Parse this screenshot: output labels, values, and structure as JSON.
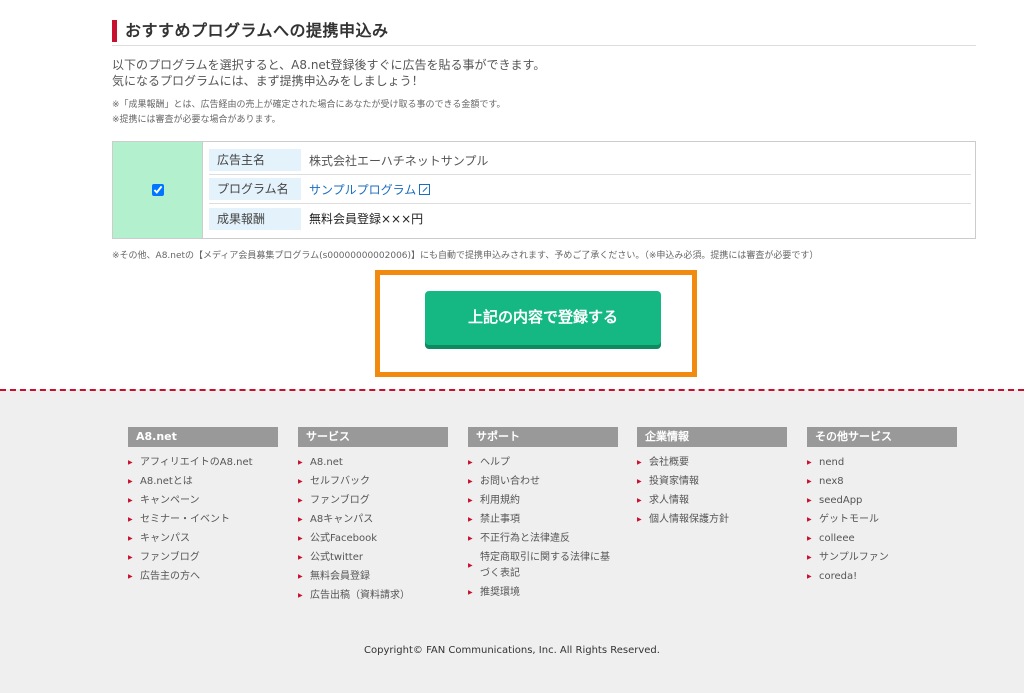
{
  "section": {
    "title": "おすすめプログラムへの提携申込み",
    "intro_line1": "以下のプログラムを選択すると、A8.net登録後すぐに広告を貼る事ができます。",
    "intro_line2": "気になるプログラムには、まず提携申込みをしましょう！",
    "note1": "※「成果報酬」とは、広告経由の売上が確定された場合にあなたが受け取る事のできる金額です。",
    "note2": "※提携には審査が必要な場合があります。"
  },
  "program": {
    "checked": true,
    "rows": [
      {
        "label": "広告主名",
        "value": "株式会社エーハチネットサンプル"
      },
      {
        "label": "プログラム名",
        "value": "サンプルプログラム"
      },
      {
        "label": "成果報酬",
        "value": "無料会員登録×××円"
      }
    ]
  },
  "auto_note": "※その他、A8.netの【メディア会員募集プログラム(s00000000002006)】にも自動で提携申込みされます、予めご了承ください。（※申込み必須。提携には審査が必要です）",
  "submit_label": "上記の内容で登録する",
  "colors": {
    "accent_red": "#c8102e",
    "button_green": "#15b883",
    "highlight_orange": "#f28a0f",
    "check_cell_bg": "#b3f0cd"
  },
  "footer": {
    "columns": [
      {
        "head": "A8.net",
        "items": [
          "アフィリエイトのA8.net",
          "A8.netとは",
          "キャンペーン",
          "セミナー・イベント",
          "キャンパス",
          "ファンブログ",
          "広告主の方へ"
        ]
      },
      {
        "head": "サービス",
        "items": [
          "A8.net",
          "セルフバック",
          "ファンブログ",
          "A8キャンパス",
          "公式Facebook",
          "公式twitter",
          "無料会員登録",
          "広告出稿（資料請求）"
        ]
      },
      {
        "head": "サポート",
        "items": [
          "ヘルプ",
          "お問い合わせ",
          "利用規約",
          "禁止事項",
          "不正行為と法律違反",
          "特定商取引に関する法律に基づく表記",
          "推奨環境"
        ]
      },
      {
        "head": "企業情報",
        "items": [
          "会社概要",
          "投資家情報",
          "求人情報",
          "個人情報保護方針"
        ]
      },
      {
        "head": "その他サービス",
        "items": [
          "nend",
          "nex8",
          "seedApp",
          "ゲットモール",
          "colleee",
          "サンプルファン",
          "coreda!"
        ]
      }
    ],
    "copyright": "Copyright© FAN Communications, Inc. All Rights Reserved."
  }
}
